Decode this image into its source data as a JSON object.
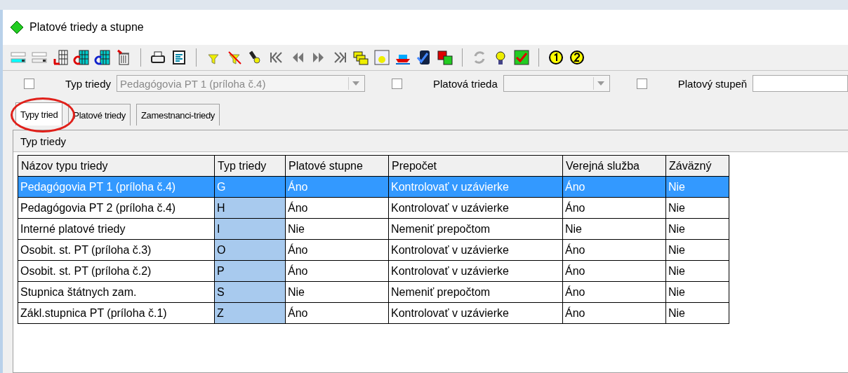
{
  "window": {
    "title": "Platové triedy a stupne"
  },
  "filters": [
    {
      "label": "Typ triedy",
      "checked": false,
      "value": "Pedagógovia PT 1 (príloha č.4)",
      "kind": "combo"
    },
    {
      "label": "Platová trieda",
      "checked": false,
      "kind": "combo"
    },
    {
      "label": "Platový stupeň",
      "checked": false,
      "kind": "field"
    }
  ],
  "tabs": [
    {
      "label": "Typy tried",
      "selected": true
    },
    {
      "label": "Platové triedy",
      "selected": false
    },
    {
      "label": "Zamestnanci-triedy",
      "selected": false
    }
  ],
  "panel": {
    "title": "Typ triedy"
  },
  "table": {
    "columns": [
      "Názov typu triedy",
      "Typ triedy",
      "Platové stupne",
      "Prepočet",
      "Verejná služba",
      "Záväzný"
    ],
    "rows": [
      {
        "selected": true,
        "cells": [
          "Pedagógovia PT 1 (príloha č.4)",
          "G",
          "Áno",
          "Kontrolovať v uzávierke",
          "Áno",
          "Nie"
        ]
      },
      {
        "selected": false,
        "cells": [
          "Pedagógovia PT 2 (príloha č.4)",
          "H",
          "Áno",
          "Kontrolovať v uzávierke",
          "Áno",
          "Nie"
        ]
      },
      {
        "selected": false,
        "cells": [
          "Interné platové triedy",
          "I",
          "Nie",
          "Nemeniť prepočtom",
          "Nie",
          "Nie"
        ]
      },
      {
        "selected": false,
        "cells": [
          "Osobit. st. PT (príloha č.3)",
          "O",
          "Áno",
          "Kontrolovať v uzávierke",
          "Áno",
          "Nie"
        ]
      },
      {
        "selected": false,
        "cells": [
          "Osobit. st. PT (príloha č.2)",
          "P",
          "Áno",
          "Kontrolovať v uzávierke",
          "Áno",
          "Nie"
        ]
      },
      {
        "selected": false,
        "cells": [
          "Stupnica štátnych zam.",
          "S",
          "Nie",
          "Nemeniť prepočtom",
          "Áno",
          "Nie"
        ]
      },
      {
        "selected": false,
        "cells": [
          "Zákl.stupnica PT (príloha č.1)",
          "Z",
          "Áno",
          "Kontrolovať v uzávierke",
          "Áno",
          "Nie"
        ]
      }
    ]
  }
}
